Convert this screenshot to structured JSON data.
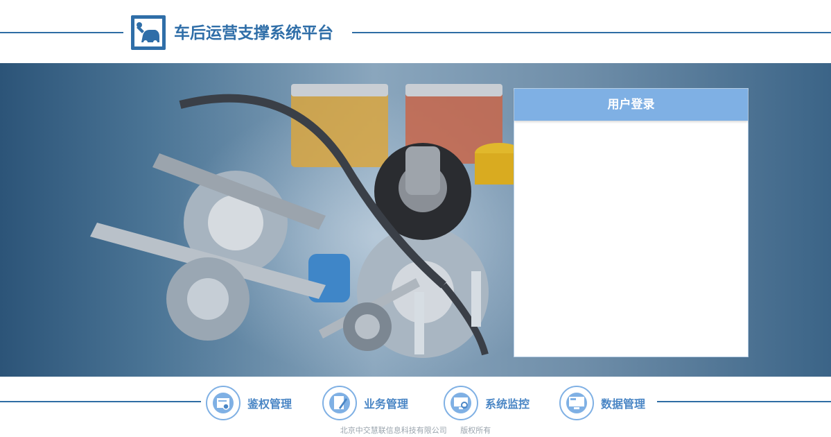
{
  "header": {
    "title": "车后运营支撑系统平台",
    "logo_icon": "wrench-car-icon"
  },
  "login": {
    "title": "用户登录"
  },
  "nav": [
    {
      "label": "鉴权管理",
      "icon": "certificate-icon"
    },
    {
      "label": "业务管理",
      "icon": "document-pen-icon"
    },
    {
      "label": "系统监控",
      "icon": "monitor-search-icon"
    },
    {
      "label": "数据管理",
      "icon": "computer-screen-icon"
    }
  ],
  "footer": {
    "company": "北京中交慧联信息科技有限公司",
    "rights": "版权所有"
  },
  "colors": {
    "brand": "#2f6ea8",
    "accent": "#7fb0e4"
  }
}
